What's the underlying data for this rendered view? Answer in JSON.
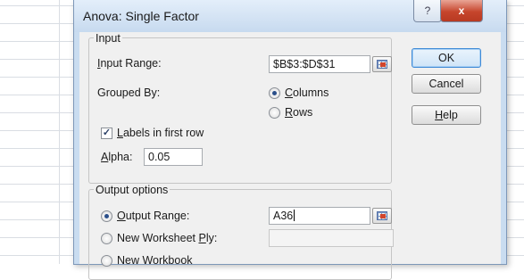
{
  "dialog": {
    "title": "Anova: Single Factor",
    "help_icon": "?",
    "close_icon": "x"
  },
  "input_group": {
    "legend": "Input",
    "input_range_label": "Input Range:",
    "input_range_value": "$B$3:$D$31",
    "grouped_by_label": "Grouped By:",
    "columns_label": "Columns",
    "rows_label": "Rows",
    "grouped_by_selected": "Columns",
    "labels_first_row_label": "Labels in first row",
    "labels_first_row_checked": true,
    "alpha_label": "Alpha:",
    "alpha_value": "0.05"
  },
  "output_group": {
    "legend": "Output options",
    "output_range_label": "Output Range:",
    "output_range_value": "A36",
    "new_worksheet_label": "New Worksheet Ply:",
    "new_worksheet_value": "",
    "new_workbook_label": "New Workbook",
    "selected": "Output Range"
  },
  "buttons": {
    "ok": "OK",
    "cancel": "Cancel",
    "help": "Help"
  }
}
